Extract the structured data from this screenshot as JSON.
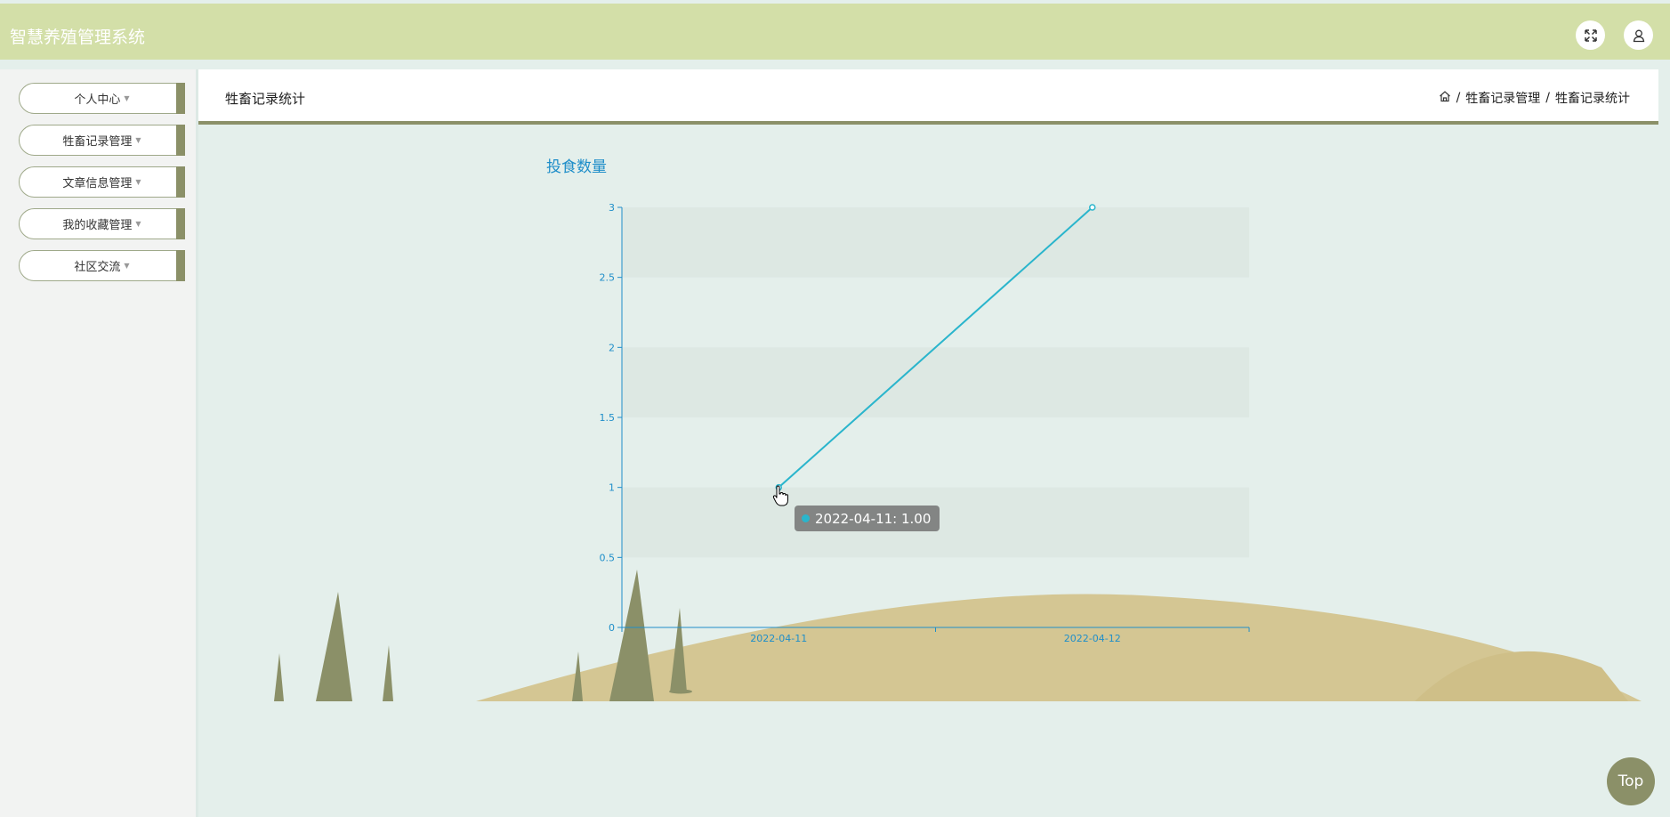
{
  "app": {
    "title": "智慧养殖管理系统"
  },
  "header_icons": {
    "fullscreen": "expand-arrows-icon",
    "user": "user-icon"
  },
  "sidebar": {
    "items": [
      {
        "label": "个人中心"
      },
      {
        "label": "牲畜记录管理"
      },
      {
        "label": "文章信息管理"
      },
      {
        "label": "我的收藏管理"
      },
      {
        "label": "社区交流"
      }
    ]
  },
  "page": {
    "title": "牲畜记录统计",
    "breadcrumb": [
      {
        "icon": "home-icon"
      },
      {
        "label": "牲畜记录管理"
      },
      {
        "label": "牲畜记录统计"
      }
    ],
    "separator": "/"
  },
  "chart_data": {
    "type": "line",
    "title": "投食数量",
    "x": [
      "2022-04-11",
      "2022-04-12"
    ],
    "series": [
      {
        "values": [
          1,
          3
        ],
        "color": "#2ab5cc"
      }
    ],
    "ylim": [
      0,
      3
    ],
    "yticks": [
      "0",
      "0.5",
      "1",
      "1.5",
      "2",
      "2.5",
      "3"
    ],
    "grid": "alternating horizontal bands",
    "tooltip": {
      "text": "2022-04-11: 1.00"
    }
  },
  "colors": {
    "accent": "#8b9068",
    "topbar": "#d3dfa8",
    "axis": "#1f8ec9",
    "line": "#2ab5cc"
  },
  "back_to_top": {
    "label": "Top"
  }
}
